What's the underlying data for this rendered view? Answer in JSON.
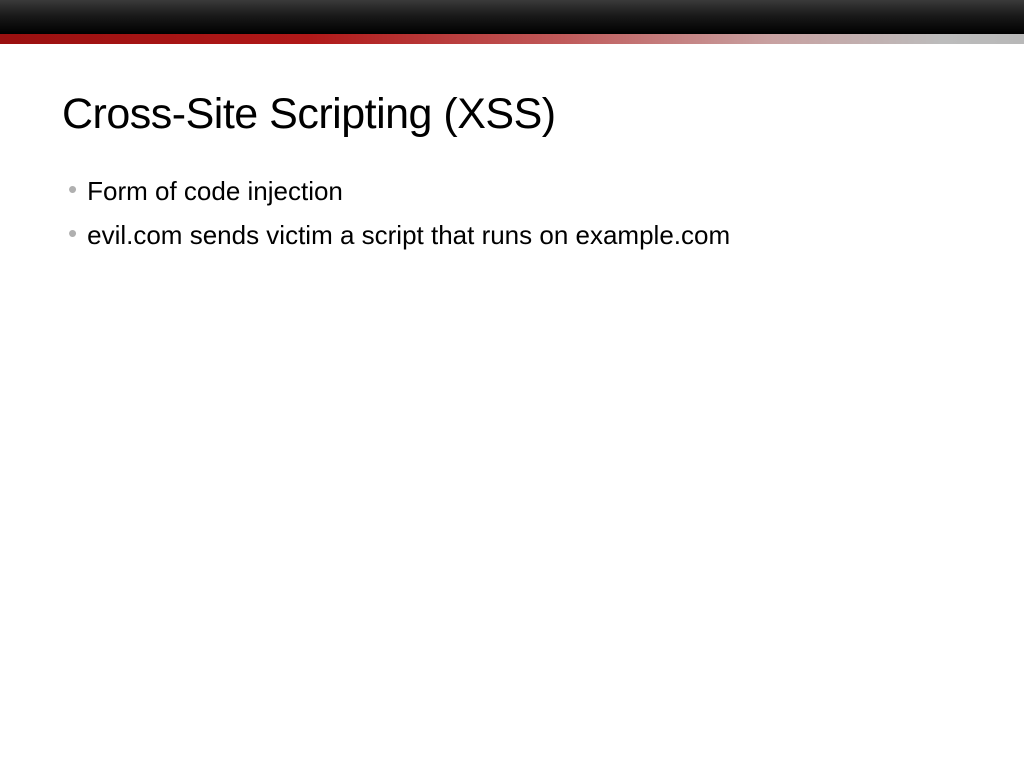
{
  "slide": {
    "title": "Cross-Site Scripting (XSS)",
    "bullets": [
      "Form of code injection",
      "evil.com sends victim a script that runs on example.com"
    ]
  }
}
